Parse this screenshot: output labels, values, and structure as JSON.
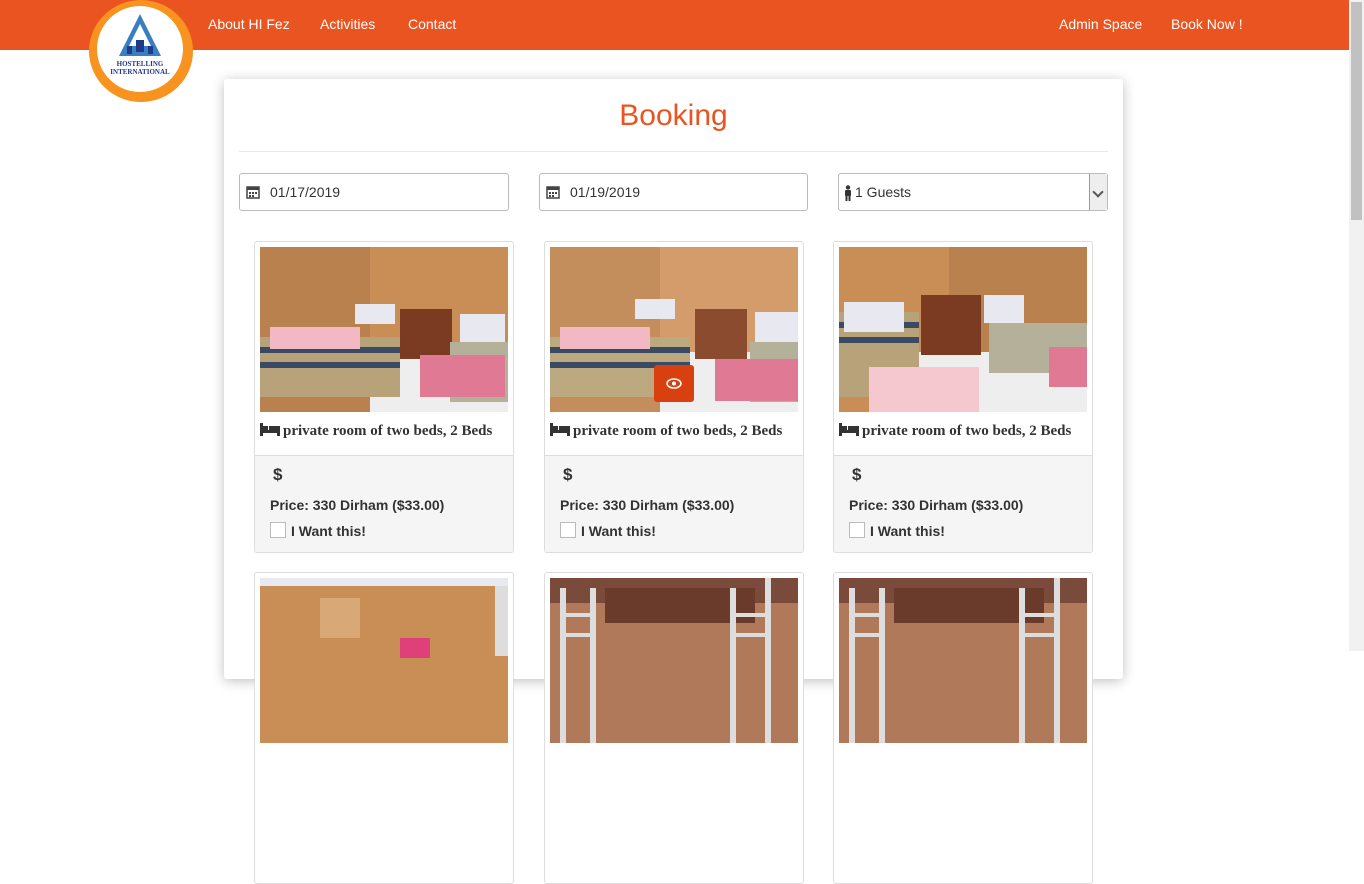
{
  "nav": {
    "logo_text": [
      "HOSTELLING",
      "INTERNATIONAL"
    ],
    "links": [
      "About HI Fez",
      "Activities",
      "Contact"
    ],
    "right_links": [
      "Admin Space",
      "Book Now !"
    ]
  },
  "booking": {
    "title": "Booking",
    "checkin": "01/17/2019",
    "checkout": "01/19/2019",
    "guests": "1 Guests"
  },
  "rooms": [
    {
      "title": "private room of two beds, 2 Beds",
      "currency": "$",
      "price": "Price: 330 Dirham ($33.00)",
      "want_label": "I Want this!"
    },
    {
      "title": "private room of two beds, 2 Beds",
      "currency": "$",
      "price": "Price: 330 Dirham ($33.00)",
      "want_label": "I Want this!"
    },
    {
      "title": "private room of two beds, 2 Beds",
      "currency": "$",
      "price": "Price: 330 Dirham ($33.00)",
      "want_label": "I Want this!"
    }
  ],
  "colors": {
    "brand": "#e95420",
    "logo_ring": "#f7931e",
    "logo_text": "#1e3a8a"
  },
  "icons": [
    "calendar-icon",
    "person-icon",
    "bed-icon",
    "eye-icon",
    "chevron-down-icon"
  ]
}
